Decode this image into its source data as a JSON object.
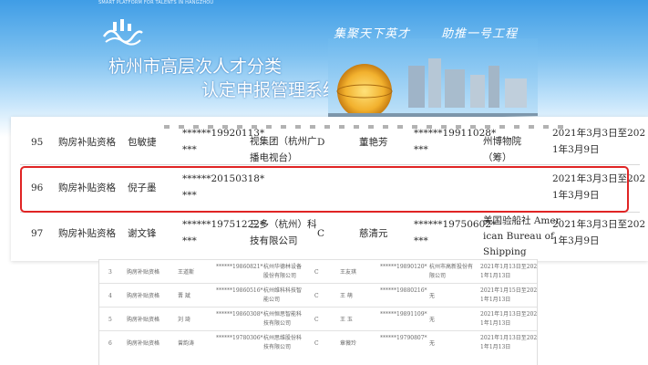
{
  "header": {
    "subtitle": "SMART PLATFORM FOR TALENTS IN HANGZHOU",
    "title_line1": "杭州市高层次人才分类",
    "title_line2": "认定申报管理系统",
    "slogan_left": "集聚天下英才",
    "slogan_right": "助推一号工程"
  },
  "zoom_table": {
    "rows": [
      {
        "no": "95",
        "type": "购房补贴资格",
        "name": "包敏捷",
        "id_line1": "******19920113*",
        "id_line2": "***",
        "company_line1": "视集团（杭州广",
        "company_line2": "播电视台）",
        "level": "D",
        "spouse": "董艳芳",
        "spouse_id_line1": "******19911028*",
        "spouse_id_line2": "***",
        "spouse_company_line1": "州博物院",
        "spouse_company_line2": "（筹）",
        "period_line1": "2021年3月3日至202",
        "period_line2": "1年3月9日"
      },
      {
        "no": "96",
        "type": "购房补贴资格",
        "name": "倪子墨",
        "id_line1": "******20150318*",
        "id_line2": "***",
        "period_line1": "2021年3月3日至202",
        "period_line2": "1年3月9日"
      },
      {
        "no": "97",
        "type": "购房补贴资格",
        "name": "谢文锋",
        "id_line1": "******19751222*",
        "id_line2": "***",
        "company_line1": "三多（杭州）科",
        "company_line2": "技有限公司",
        "level": "C",
        "spouse": "慈清元",
        "spouse_id_line1": "******19750602*",
        "spouse_id_line2": "***",
        "spouse_company_line1": "美国验船社 Amer",
        "spouse_company_line2": "ican Bureau of",
        "spouse_company_line3": "Shipping",
        "period_line1": "2021年3月3日至202",
        "period_line2": "1年3月9日"
      }
    ]
  },
  "lower_table": {
    "rows": [
      {
        "no": "3",
        "type": "购房补贴资格",
        "name": "王道斯",
        "id": "******19860821*",
        "company_line1": "杭州华德林设备",
        "company_line2": "股份有限公司",
        "level": "C",
        "spouse": "王友琪",
        "spouse_id": "******19890120*",
        "spouse_company": "杭州市高新投份有",
        "spouse_company_line2": "限公司",
        "period_line1": "2021年1月13日至202",
        "period_line2": "1年1月13日"
      },
      {
        "no": "4",
        "type": "购房补贴资格",
        "name": "晋 斌",
        "id": "******19860516*",
        "company_line1": "杭州维科科技智",
        "company_line2": "能公司",
        "level": "C",
        "spouse": "王 萌",
        "spouse_id": "******19880216*",
        "spouse_company": "无",
        "spouse_company_line2": "",
        "period_line1": "2021年1月15日至202",
        "period_line2": "1年1月13日"
      },
      {
        "no": "5",
        "type": "购房补贴资格",
        "name": "刘 琦",
        "id": "******19860308*",
        "company_line1": "杭州恒思智能科",
        "company_line2": "技有限公司",
        "level": "C",
        "spouse": "王 玉",
        "spouse_id": "******19891109*",
        "spouse_company": "无",
        "spouse_company_line2": "",
        "period_line1": "2021年1月13日至202",
        "period_line2": "1年1月13日"
      },
      {
        "no": "6",
        "type": "购房补贴资格",
        "name": "曾韵涛",
        "id": "******19780306*",
        "company_line1": "杭州思维股份科",
        "company_line2": "技有限公司",
        "level": "C",
        "spouse": "章薇玲",
        "spouse_id": "******19790807*",
        "spouse_company": "无",
        "spouse_company_line2": "",
        "period_line1": "2021年1月13日至202",
        "period_line2": "1年1月13日"
      }
    ]
  },
  "colors": {
    "banner_top": "#3f9de6",
    "highlight_border": "#e02424"
  }
}
